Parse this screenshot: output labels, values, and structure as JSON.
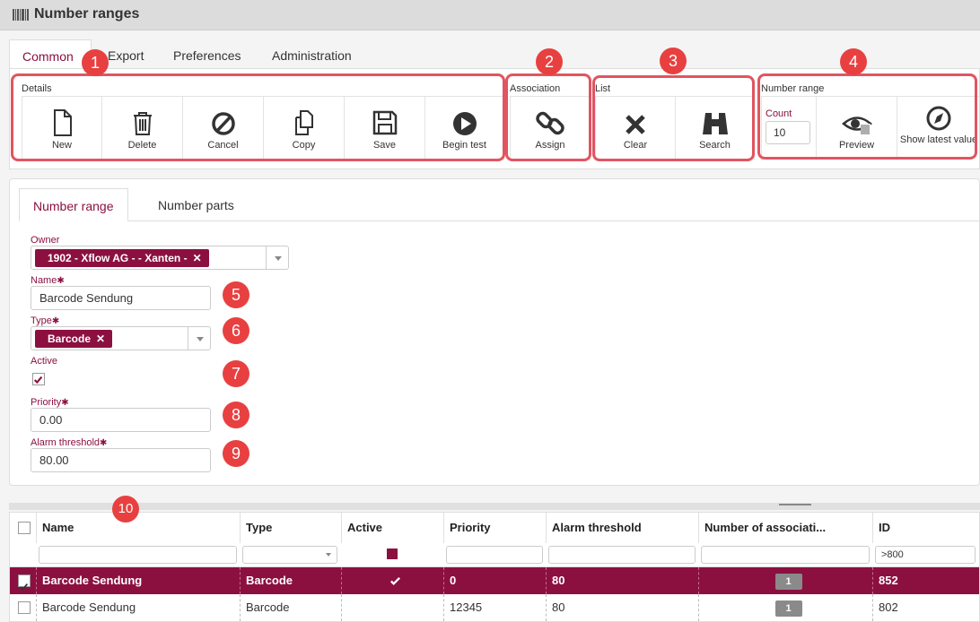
{
  "window": {
    "title": "Number ranges",
    "icon": "barcode-icon"
  },
  "main_tabs": [
    {
      "label": "Common",
      "active": true
    },
    {
      "label": "Export",
      "active": false
    },
    {
      "label": "Preferences",
      "active": false
    },
    {
      "label": "Administration",
      "active": false
    }
  ],
  "ribbon": {
    "details": {
      "label": "Details",
      "buttons": [
        {
          "label": "New",
          "icon": "new-document-icon"
        },
        {
          "label": "Delete",
          "icon": "trash-icon"
        },
        {
          "label": "Cancel",
          "icon": "cancel-icon"
        },
        {
          "label": "Copy",
          "icon": "copy-icon"
        },
        {
          "label": "Save",
          "icon": "save-icon"
        },
        {
          "label": "Begin test",
          "icon": "play-icon"
        }
      ]
    },
    "association": {
      "label": "Association",
      "buttons": [
        {
          "label": "Assign",
          "icon": "link-icon"
        }
      ]
    },
    "list": {
      "label": "List",
      "buttons": [
        {
          "label": "Clear",
          "icon": "x-icon"
        },
        {
          "label": "Search",
          "icon": "binoculars-icon"
        }
      ]
    },
    "number_range": {
      "label": "Number range",
      "count_label": "Count",
      "count_value": "10",
      "buttons": [
        {
          "label": "Preview",
          "icon": "preview-icon"
        },
        {
          "label": "Show latest value",
          "icon": "compass-icon"
        }
      ]
    }
  },
  "callouts": [
    "1",
    "2",
    "3",
    "4",
    "5",
    "6",
    "7",
    "8",
    "9",
    "10"
  ],
  "sub_tabs": [
    {
      "label": "Number range",
      "active": true
    },
    {
      "label": "Number parts",
      "active": false
    }
  ],
  "form": {
    "owner": {
      "label": "Owner",
      "chip": "1902 - Xflow AG - - Xanten -"
    },
    "name": {
      "label": "Name",
      "value": "Barcode Sendung"
    },
    "type": {
      "label": "Type",
      "chip": "Barcode"
    },
    "active": {
      "label": "Active",
      "checked": true
    },
    "priority": {
      "label": "Priority",
      "value": "0.00"
    },
    "alarm_threshold": {
      "label": "Alarm threshold",
      "value": "80.00"
    },
    "required_mark": "✱"
  },
  "grid": {
    "columns": [
      "Name",
      "Type",
      "Active",
      "Priority",
      "Alarm threshold",
      "Number of associati...",
      "ID"
    ],
    "id_filter": ">800",
    "rows": [
      {
        "selected": true,
        "name": "Barcode Sendung",
        "type": "Barcode",
        "active": true,
        "priority": "0",
        "alarm": "80",
        "assoc": "1",
        "id": "852"
      },
      {
        "selected": false,
        "name": "Barcode Sendung",
        "type": "Barcode",
        "active": false,
        "priority": "12345",
        "alarm": "80",
        "assoc": "1",
        "id": "802"
      }
    ]
  },
  "colors": {
    "accent": "#8b1040",
    "callout": "#e84040",
    "highlight_box": "#e05560"
  }
}
